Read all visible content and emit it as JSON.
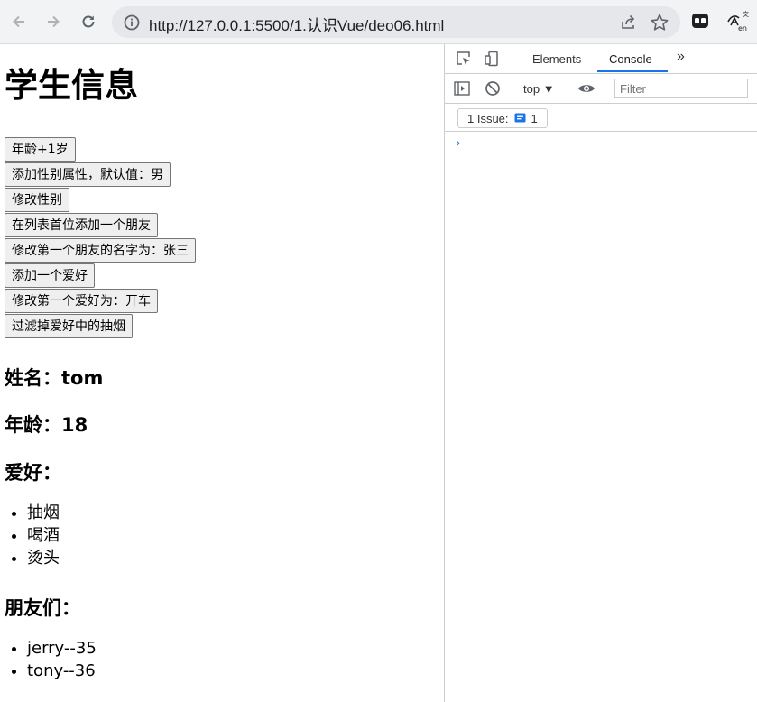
{
  "browser": {
    "url": "http://127.0.0.1:5500/1.认识Vue/deo06.html"
  },
  "page": {
    "title": "学生信息",
    "buttons": [
      "年龄+1岁",
      "添加性别属性，默认值：男",
      "修改性别",
      "在列表首位添加一个朋友",
      "修改第一个朋友的名字为：张三",
      "添加一个爱好",
      "修改第一个爱好为：开车",
      "过滤掉爱好中的抽烟"
    ],
    "name_line": "姓名：tom",
    "age_line": "年龄：18",
    "hobby_heading": "爱好：",
    "hobbies": [
      "抽烟",
      "喝酒",
      "烫头"
    ],
    "friends_heading": "朋友们：",
    "friends": [
      "jerry--35",
      "tony--36"
    ]
  },
  "devtools": {
    "tabs": [
      "Elements",
      "Console"
    ],
    "active_tab": "Console",
    "context": "top",
    "filter_placeholder": "Filter",
    "issues_label": "1 Issue:",
    "issues_count": "1",
    "prompt": "›"
  },
  "colors": {
    "accent": "#1a73e8",
    "toolbar_bg": "#f1f3f4"
  }
}
